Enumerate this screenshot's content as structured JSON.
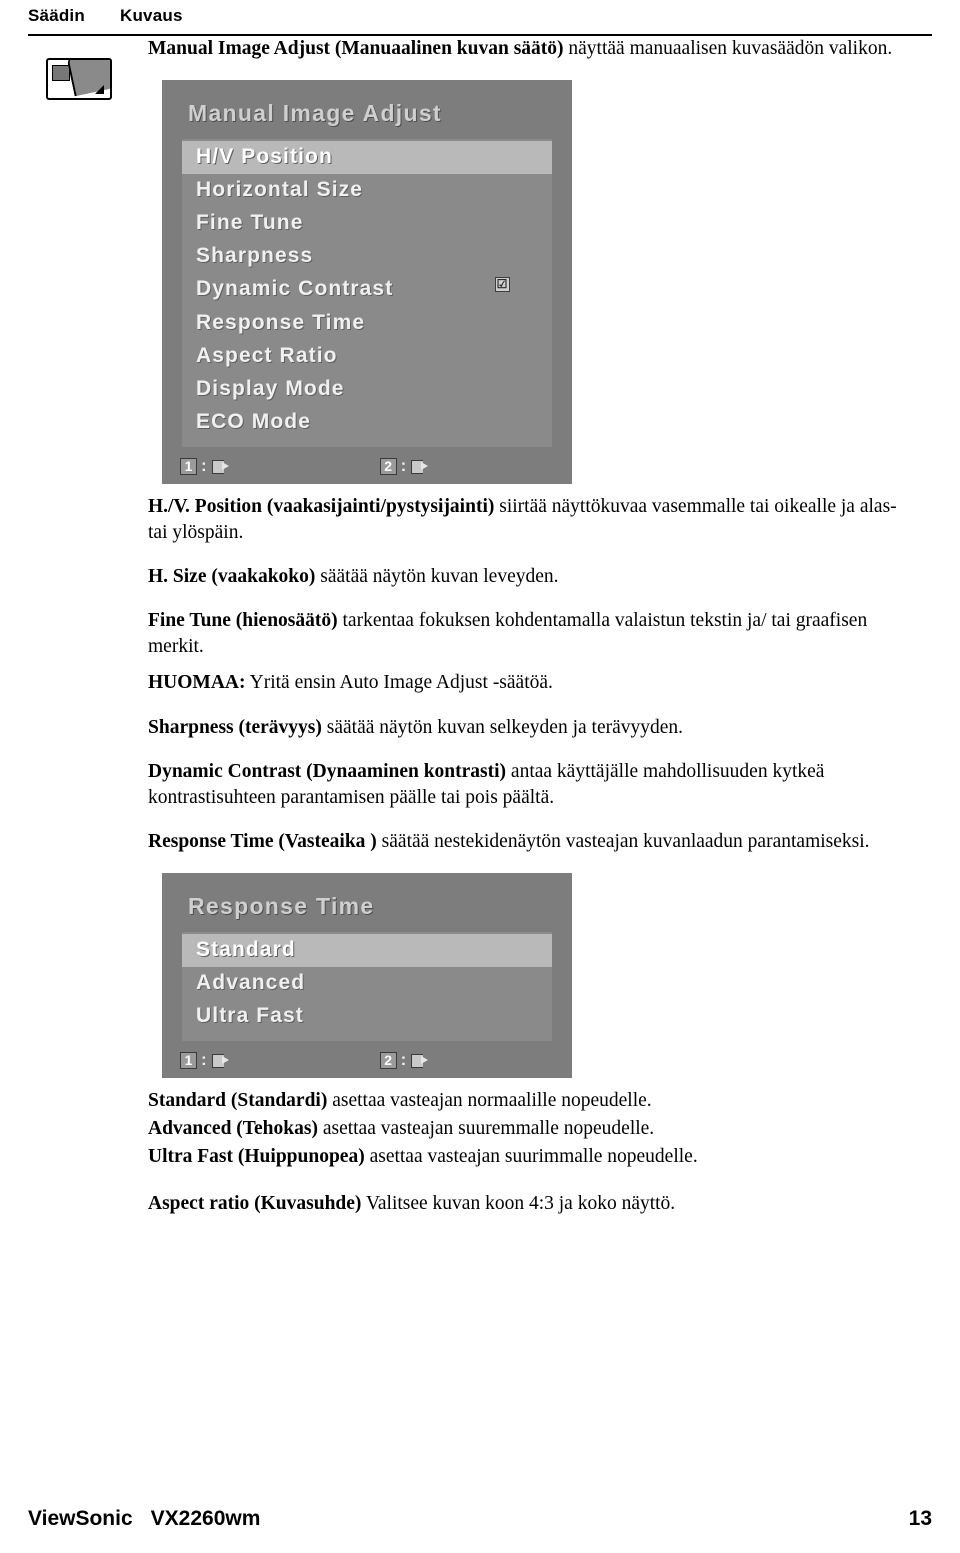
{
  "header": {
    "col1": "Säädin",
    "col2": "Kuvaus"
  },
  "icons": {
    "manual_image_adjust": "monitor-adjust-icon"
  },
  "intro": {
    "bold": "Manual Image Adjust (Manuaalinen kuvan säätö)",
    "rest": " näyttää manuaalisen kuvasäädön valikon."
  },
  "osd1": {
    "title": "Manual Image Adjust",
    "rows": [
      {
        "label": "H/V Position",
        "selected": true,
        "check": false
      },
      {
        "label": "Horizontal Size",
        "selected": false,
        "check": false
      },
      {
        "label": "Fine Tune",
        "selected": false,
        "check": false
      },
      {
        "label": "Sharpness",
        "selected": false,
        "check": false
      },
      {
        "label": "Dynamic Contrast",
        "selected": false,
        "check": true,
        "check_glyph": "☑"
      },
      {
        "label": "Response Time",
        "selected": false,
        "check": false
      },
      {
        "label": "Aspect Ratio",
        "selected": false,
        "check": false
      },
      {
        "label": "Display Mode",
        "selected": false,
        "check": false
      },
      {
        "label": "ECO Mode",
        "selected": false,
        "check": false
      }
    ],
    "footer": {
      "key1": "1",
      "key2": "2",
      "colon": ":",
      "enter1": "enter-icon",
      "enter2": "enter-icon"
    }
  },
  "paragraphs": [
    {
      "bold": "H./V. Position (vaakasijainti/pystysijainti)",
      "rest": " siirtää näyttökuvaa vasemmalle tai oikealle ja alas- tai ylöspäin."
    },
    {
      "bold": "H. Size (vaakakoko)",
      "rest": " säätää näytön kuvan leveyden."
    },
    {
      "bold": "Fine Tune (hienosäätö)",
      "rest": " tarkentaa fokuksen kohdentamalla valaistun tekstin ja/ tai graafisen merkit."
    },
    {
      "bold": "HUOMAA:",
      "rest": " Yritä ensin Auto Image Adjust -säätöä."
    },
    {
      "bold": "Sharpness (terävyys)",
      "rest": " säätää näytön kuvan selkeyden ja terävyyden."
    },
    {
      "bold": "Dynamic Contrast (Dynaaminen kontrasti)",
      "rest": " antaa käyttäjälle mahdollisuuden kytkeä kontrastisuhteen parantamisen päälle tai pois päältä."
    },
    {
      "bold": "Response Time (Vasteaika )",
      "rest": " säätää nestekidenäytön vasteajan kuvanlaadun parantamiseksi."
    }
  ],
  "osd2": {
    "title": "Response Time",
    "rows": [
      {
        "label": "Standard",
        "selected": true
      },
      {
        "label": "Advanced",
        "selected": false
      },
      {
        "label": "Ultra Fast",
        "selected": false
      }
    ],
    "footer": {
      "key1": "1",
      "key2": "2",
      "colon": ":"
    }
  },
  "response_items": [
    {
      "bold": "Standard (Standardi)",
      "rest": " asettaa vasteajan normaalille nopeudelle."
    },
    {
      "bold": "Advanced (Tehokas)",
      "rest": " asettaa vasteajan suuremmalle nopeudelle."
    },
    {
      "bold": "Ultra Fast (Huippunopea)",
      "rest": " asettaa vasteajan suurimmalle nopeudelle."
    }
  ],
  "aspect": {
    "bold": "Aspect ratio (Kuvasuhde)",
    "rest": " Valitsee kuvan koon 4:3 ja koko näyttö."
  },
  "footer": {
    "brand": "ViewSonic",
    "model": "VX2260wm",
    "page": "13"
  }
}
